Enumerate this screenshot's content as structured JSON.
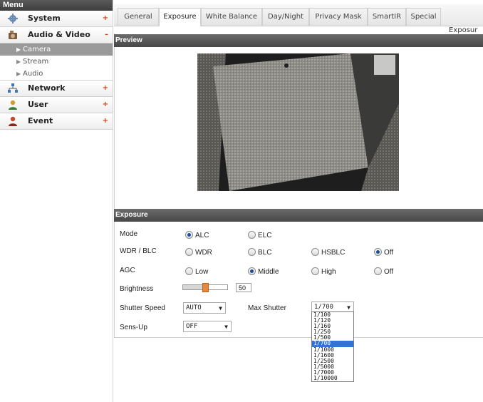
{
  "menu": {
    "title": "Menu",
    "categories": [
      {
        "label": "System",
        "sign": "+",
        "icon": "gear-icon",
        "color": "#6b8bb3"
      },
      {
        "label": "Audio & Video",
        "sign": "–",
        "icon": "camera-icon",
        "color": "#7c5a3a"
      },
      {
        "label": "Network",
        "sign": "+",
        "icon": "network-icon",
        "color": "#3a78c0"
      },
      {
        "label": "User",
        "sign": "+",
        "icon": "user-icon",
        "color": "#d09a30"
      },
      {
        "label": "Event",
        "sign": "+",
        "icon": "event-icon",
        "color": "#c04b2a"
      }
    ],
    "sub_items": [
      {
        "label": "Camera",
        "active": true
      },
      {
        "label": "Stream",
        "active": false
      },
      {
        "label": "Audio",
        "active": false
      }
    ]
  },
  "tabs": [
    "General",
    "Exposure",
    "White Balance",
    "Day/Night",
    "Privacy Mask",
    "SmartIR",
    "Special"
  ],
  "active_tab": "Exposure",
  "page_label": "Exposur",
  "preview": {
    "title": "Preview"
  },
  "exposure": {
    "title": "Exposure",
    "mode": {
      "label": "Mode",
      "options": [
        "ALC",
        "ELC"
      ],
      "selected": "ALC"
    },
    "wdr": {
      "label": "WDR / BLC",
      "options": [
        "WDR",
        "BLC",
        "HSBLC",
        "Off"
      ],
      "selected": "Off"
    },
    "agc": {
      "label": "AGC",
      "options": [
        "Low",
        "Middle",
        "High",
        "Off"
      ],
      "selected": "Middle"
    },
    "brightness": {
      "label": "Brightness",
      "value": "50",
      "level": 0.5
    },
    "shutter_speed": {
      "label": "Shutter Speed",
      "value": "AUTO"
    },
    "max_shutter": {
      "label": "Max Shutter",
      "value": "1/700",
      "options": [
        "1/100",
        "1/120",
        "1/160",
        "1/250",
        "1/500",
        "1/700",
        "1/1000",
        "1/1600",
        "1/2500",
        "1/5000",
        "1/7000",
        "1/10000"
      ]
    },
    "sens_up": {
      "label": "Sens-Up",
      "value": "OFF"
    }
  }
}
